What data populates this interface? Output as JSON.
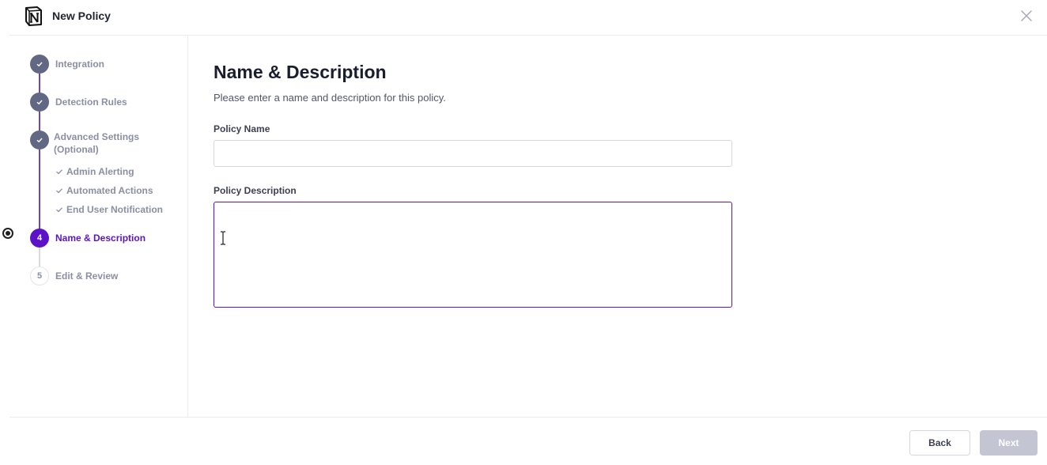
{
  "header": {
    "title": "New Policy",
    "logo_icon": "notion-logo",
    "close_icon": "close-icon"
  },
  "sidebar": {
    "steps": [
      {
        "label": "Integration",
        "state": "done",
        "indicator": "check"
      },
      {
        "label": "Detection Rules",
        "state": "done",
        "indicator": "check"
      },
      {
        "label": "Advanced Settings (Optional)",
        "state": "done",
        "indicator": "check"
      },
      {
        "label": "Name & Description",
        "state": "active",
        "indicator": "4"
      },
      {
        "label": "Edit & Review",
        "state": "todo",
        "indicator": "5"
      }
    ],
    "sub_items": [
      {
        "label": "Admin Alerting"
      },
      {
        "label": "Automated Actions"
      },
      {
        "label": "End User Notification"
      }
    ]
  },
  "main": {
    "heading": "Name & Description",
    "subheading": "Please enter a name and description for this policy.",
    "policy_name_label": "Policy Name",
    "policy_name_value": "",
    "policy_description_label": "Policy Description",
    "policy_description_value": ""
  },
  "footer": {
    "back_label": "Back",
    "next_label": "Next"
  },
  "colors": {
    "accent": "#5b12c9",
    "done_step": "#626784",
    "disabled_button": "#c3c5d3"
  }
}
